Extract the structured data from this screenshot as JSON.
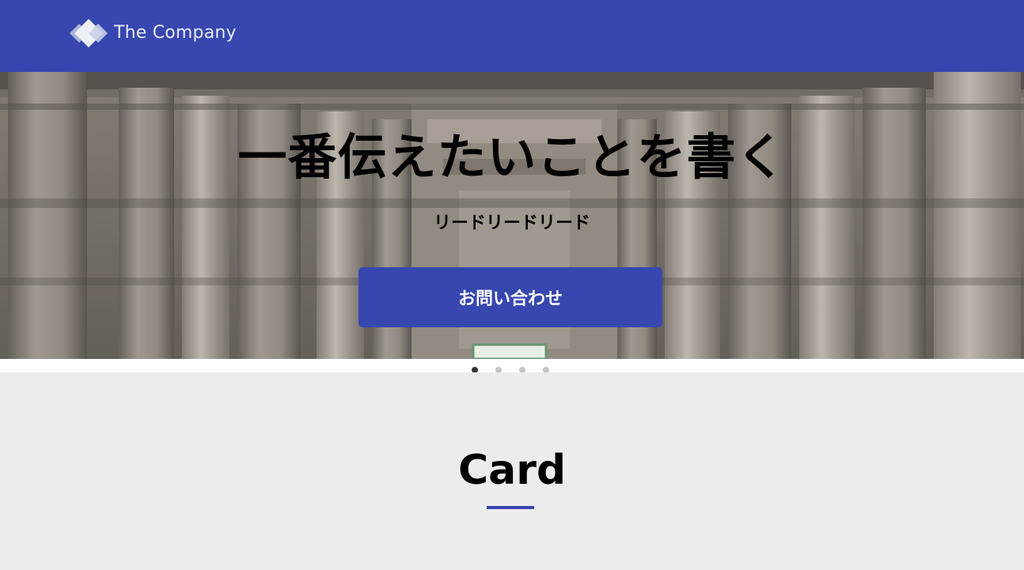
{
  "header": {
    "logo_text": "The Company",
    "logo_icon": "diamond-logo-icon",
    "background_color": "#3747af"
  },
  "hero": {
    "title": "一番伝えたいことを書く",
    "lead": "リードリードリード",
    "button_label": "お問い合わせ",
    "button_color": "#3747af",
    "background_description_icon": "stone-pillars-photo"
  },
  "carousel": {
    "slide_count": 4,
    "active_index": 0
  },
  "section": {
    "title": "Card",
    "accent_color": "#3747af"
  }
}
